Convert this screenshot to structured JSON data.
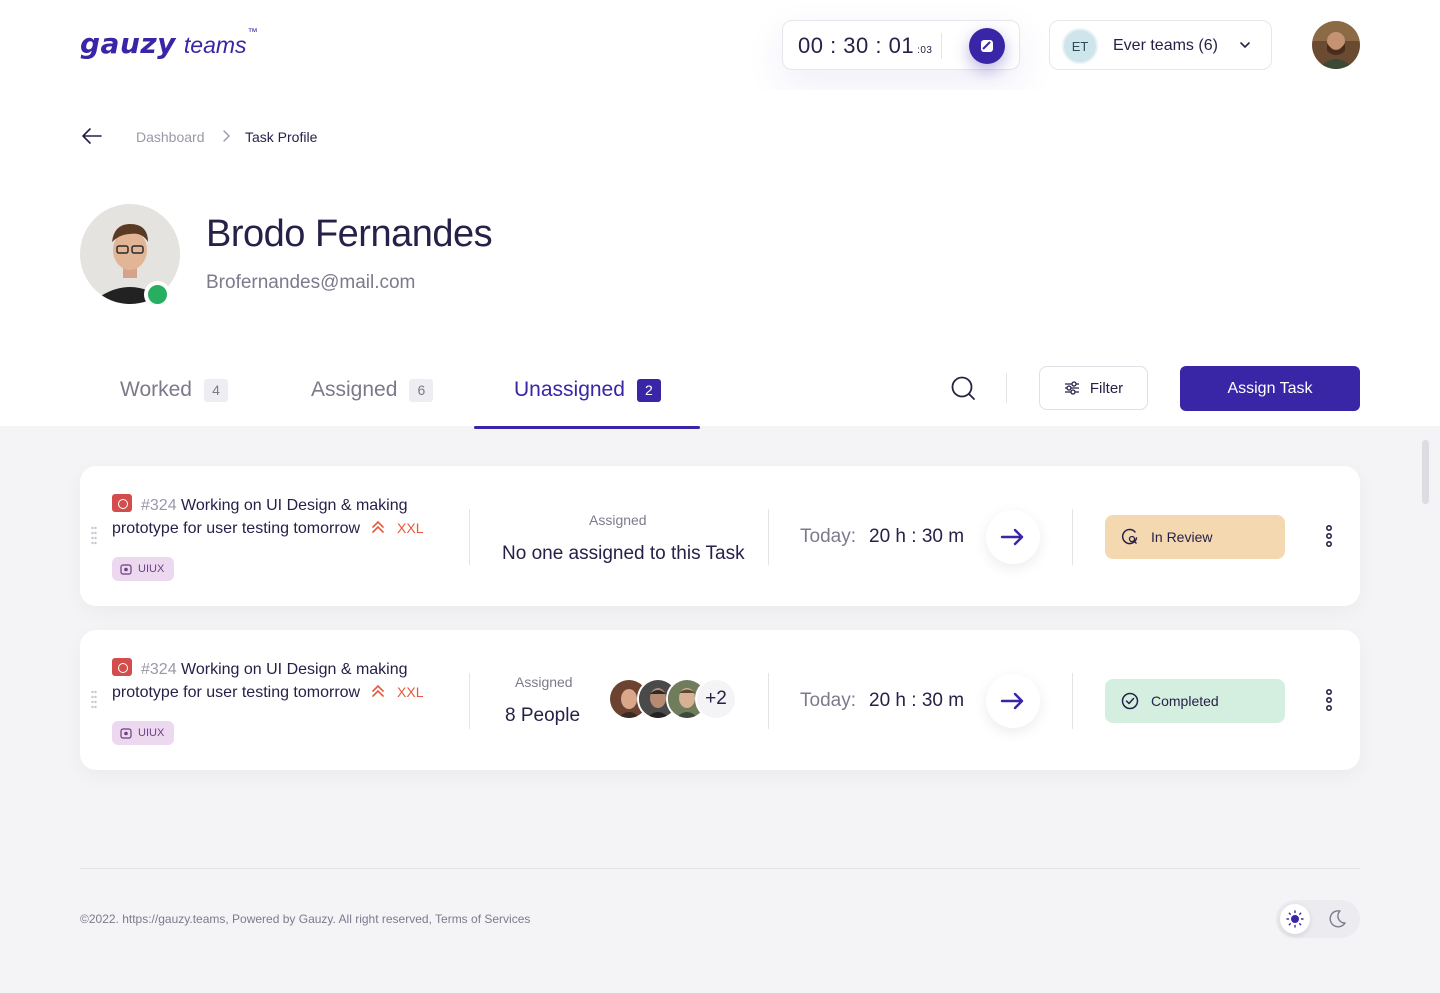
{
  "header": {
    "logo_main": "gauzy",
    "logo_sub": "teams",
    "logo_tm": "™",
    "timer": {
      "time": "00 : 30 : 01",
      "ms": ":03"
    },
    "team": {
      "initials": "ET",
      "name": "Ever teams (6)"
    }
  },
  "breadcrumb": {
    "parent": "Dashboard",
    "current": "Task Profile"
  },
  "profile": {
    "name": "Brodo Fernandes",
    "email": "Brofernandes@mail.com",
    "status_color": "#27ae60"
  },
  "tabs": [
    {
      "label": "Worked",
      "count": "4"
    },
    {
      "label": "Assigned",
      "count": "6"
    },
    {
      "label": "Unassigned",
      "count": "2"
    }
  ],
  "toolbar": {
    "filter_label": "Filter",
    "assign_label": "Assign Task"
  },
  "tasks": [
    {
      "number": "#324",
      "title": "Working on UI Design & making prototype for user testing tomorrow",
      "size": "XXL",
      "label": "UIUX",
      "assigned_label": "Assigned",
      "assigned_value": "No one assigned  to this Task",
      "today_label": "Today:",
      "today_value": "20 h : 30 m",
      "status": "In Review",
      "status_color": "#f3d8b0"
    },
    {
      "number": "#324",
      "title": "Working on UI Design & making prototype for user testing tomorrow",
      "size": "XXL",
      "label": "UIUX",
      "assigned_label": "Assigned",
      "assigned_value": "8 People",
      "more_people": "+2",
      "today_label": "Today:",
      "today_value": "20 h : 30 m",
      "status": "Completed",
      "status_color": "#d4efdf"
    }
  ],
  "footer": {
    "text": "©2022. https://gauzy.teams, Powered by Gauzy. All right reserved, Terms of Services"
  },
  "colors": {
    "primary": "#3826a6",
    "accent_orange": "#e5593a"
  }
}
